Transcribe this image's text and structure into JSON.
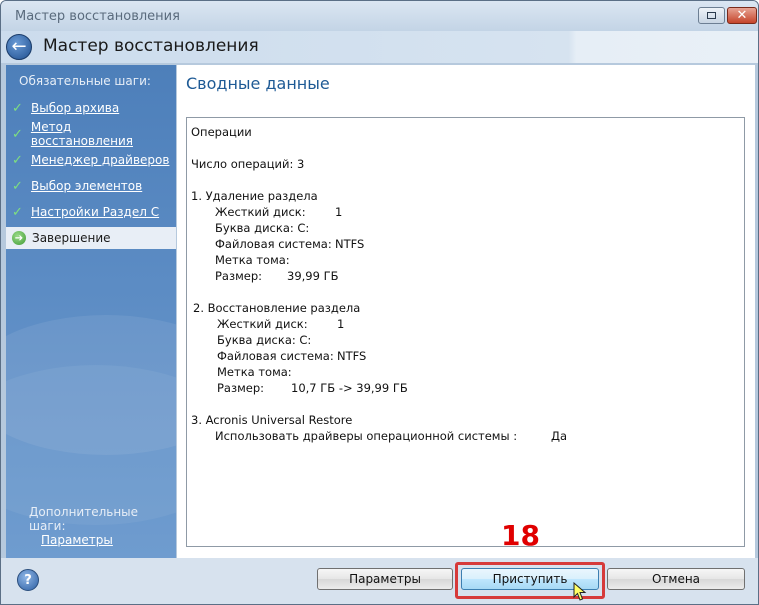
{
  "window": {
    "title": "Мастер восстановления"
  },
  "header": {
    "title": "Мастер восстановления"
  },
  "sidebar": {
    "required_heading": "Обязательные шаги:",
    "items": [
      {
        "label": "Выбор архива",
        "state": "done"
      },
      {
        "label": "Метод восстановления",
        "state": "done"
      },
      {
        "label": "Менеджер драйверов",
        "state": "done"
      },
      {
        "label": "Выбор элементов",
        "state": "done"
      },
      {
        "label": "Настройки Раздел C",
        "state": "done"
      },
      {
        "label": "Завершение",
        "state": "current"
      }
    ],
    "optional_heading": "Дополнительные шаги:",
    "optional_link": "Параметры"
  },
  "main": {
    "title": "Сводные данные",
    "summary": {
      "operations_heading": "Операции",
      "count_line": "Число операций: 3",
      "op1": {
        "title": "1. Удаление раздела",
        "disk_label": "Жесткий диск:",
        "disk_value": "1",
        "letter_label": "Буква диска: C:",
        "fs_label": "Файловая система:",
        "fs_value": "NTFS",
        "volume_label": "Метка тома:",
        "size_label": "Размер:",
        "size_value": "39,99 ГБ"
      },
      "op2": {
        "title": "2. Восстановление раздела",
        "disk_label": "Жесткий диск:",
        "disk_value": "1",
        "letter_label": "Буква диска: C:",
        "fs_label": "Файловая система:",
        "fs_value": "NTFS",
        "volume_label": "Метка тома:",
        "size_label": "Размер:",
        "size_value": "10,7 ГБ -> 39,99 ГБ"
      },
      "op3": {
        "title": "3. Acronis Universal Restore",
        "drivers_label": "Использовать драйверы операционной системы :",
        "drivers_value": "Да"
      }
    }
  },
  "footer": {
    "params_button": "Параметры",
    "start_button": "Приступить",
    "cancel_button": "Отмена"
  },
  "annotation": {
    "step_number": "18",
    "highlight_color": "#d63a3a"
  },
  "icons": {
    "back": "back-arrow-icon",
    "help": "help-icon",
    "check": "check-icon",
    "current": "current-step-arrow-icon",
    "restore": "restore-window-icon",
    "close": "close-icon",
    "cursor": "mouse-cursor-icon"
  }
}
